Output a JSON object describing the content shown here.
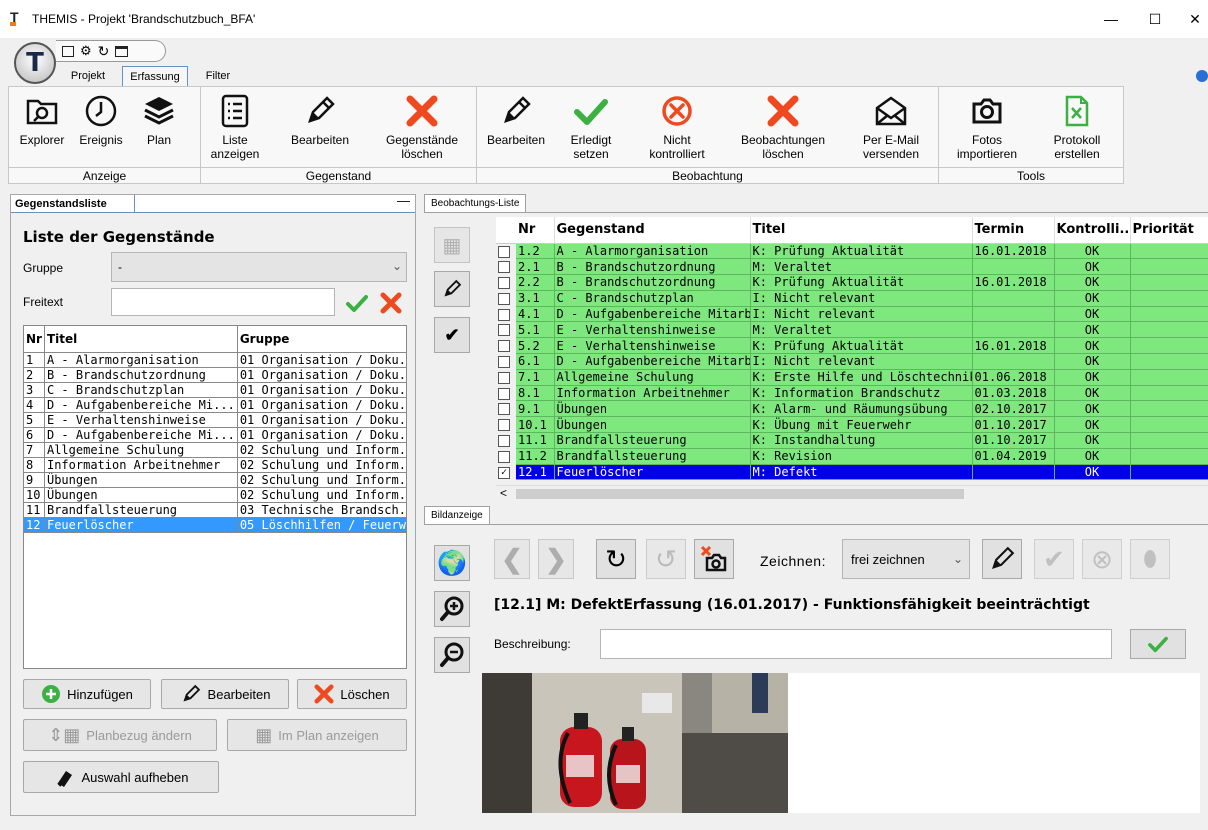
{
  "window": {
    "title": "THEMIS - Projekt 'Brandschutzbuch_BFA'",
    "logo": "T",
    "minimize": "—",
    "maximize": "☐",
    "close": "✕"
  },
  "ribbon_tabs": [
    {
      "label": "Projekt"
    },
    {
      "label": "Erfassung"
    },
    {
      "label": "Filter"
    }
  ],
  "groups": {
    "anzeige": {
      "label": "Anzeige",
      "explorer": "Explorer",
      "ereignis": "Ereignis",
      "plan": "Plan"
    },
    "gegenstand": {
      "label": "Gegenstand",
      "liste_1": "Liste",
      "liste_2": "anzeigen",
      "bearbeiten": "Bearbeiten",
      "loeschen_1": "Gegenstände",
      "loeschen_2": "löschen"
    },
    "beobachtung": {
      "label": "Beobachtung",
      "bearbeiten": "Bearbeiten",
      "erledigt_1": "Erledigt",
      "erledigt_2": "setzen",
      "nicht_1": "Nicht",
      "nicht_2": "kontrolliert",
      "loeschen_1": "Beobachtungen",
      "loeschen_2": "löschen",
      "email_1": "Per E-Mail",
      "email_2": "versenden"
    },
    "tools": {
      "label": "Tools",
      "fotos_1": "Fotos",
      "fotos_2": "importieren",
      "protokoll_1": "Protokoll",
      "protokoll_2": "erstellen"
    }
  },
  "left_panel": {
    "tab": "Gegenstandsliste",
    "collapse": "—",
    "heading": "Liste der Gegenstände",
    "gruppe_label": "Gruppe",
    "gruppe_value": "-",
    "freitext_label": "Freitext",
    "freitext_value": "",
    "columns": [
      "Nr",
      "Titel",
      "Gruppe"
    ],
    "rows": [
      [
        "1",
        "A - Alarmorganisation",
        "01 Organisation / Doku..."
      ],
      [
        "2",
        "B - Brandschutzordnung",
        "01 Organisation / Doku..."
      ],
      [
        "3",
        "C - Brandschutzplan",
        "01 Organisation / Doku..."
      ],
      [
        "4",
        "D - Aufgabenbereiche Mi...",
        "01 Organisation / Doku..."
      ],
      [
        "5",
        "E - Verhaltenshinweise",
        "01 Organisation / Doku..."
      ],
      [
        "6",
        "D - Aufgabenbereiche Mi...",
        "01 Organisation / Doku..."
      ],
      [
        "7",
        "Allgemeine Schulung",
        "02 Schulung und Inform..."
      ],
      [
        "8",
        "Information Arbeitnehmer",
        "02 Schulung und Inform..."
      ],
      [
        "9",
        "Übungen",
        "02 Schulung und Inform..."
      ],
      [
        "10",
        "Übungen",
        "02 Schulung und Inform..."
      ],
      [
        "11",
        "Brandfallsteuerung",
        "03 Technische Brandsch..."
      ],
      [
        "12",
        "Feuerlöscher",
        "05 Löschhilfen / Feuerw..."
      ]
    ],
    "selected_row": 12,
    "btn_add": "Hinzufügen",
    "btn_edit": "Bearbeiten",
    "btn_delete": "Löschen",
    "btn_planbezug": "Planbezug ändern",
    "btn_implan": "Im Plan anzeigen",
    "btn_auswahl": "Auswahl aufheben"
  },
  "obs_panel": {
    "tab": "Beobachtungs-Liste",
    "columns": [
      "Nr",
      "Gegenstand",
      "Titel",
      "Termin",
      "Kontrolli...",
      "Priorität"
    ],
    "rows": [
      [
        "1.2",
        "A - Alarmorganisation",
        "K: Prüfung Aktualität",
        "16.01.2018",
        "OK",
        ""
      ],
      [
        "2.1",
        "B - Brandschutzordnung",
        "M: Veraltet",
        "",
        "OK",
        ""
      ],
      [
        "2.2",
        "B - Brandschutzordnung",
        "K: Prüfung Aktualität",
        "16.01.2018",
        "OK",
        ""
      ],
      [
        "3.1",
        "C - Brandschutzplan",
        "I: Nicht relevant",
        "",
        "OK",
        ""
      ],
      [
        "4.1",
        "D - Aufgabenbereiche Mitarb...",
        "I: Nicht relevant",
        "",
        "OK",
        ""
      ],
      [
        "5.1",
        "E - Verhaltenshinweise",
        "M: Veraltet",
        "",
        "OK",
        ""
      ],
      [
        "5.2",
        "E - Verhaltenshinweise",
        "K: Prüfung Aktualität",
        "16.01.2018",
        "OK",
        ""
      ],
      [
        "6.1",
        "D - Aufgabenbereiche Mitarb...",
        "I: Nicht relevant",
        "",
        "OK",
        ""
      ],
      [
        "7.1",
        "Allgemeine Schulung",
        "K: Erste Hilfe und Löschtechnik",
        "01.06.2018",
        "OK",
        ""
      ],
      [
        "8.1",
        "Information Arbeitnehmer",
        "K: Information Brandschutz",
        "01.03.2018",
        "OK",
        ""
      ],
      [
        "9.1",
        "Übungen",
        "K: Alarm- und Räumungsübung",
        "02.10.2017",
        "OK",
        ""
      ],
      [
        "10.1",
        "Übungen",
        "K: Übung mit Feuerwehr",
        "01.10.2017",
        "OK",
        ""
      ],
      [
        "11.1",
        "Brandfallsteuerung",
        "K: Instandhaltung",
        "01.10.2017",
        "OK",
        ""
      ],
      [
        "11.2",
        "Brandfallsteuerung",
        "K: Revision",
        "01.04.2019",
        "OK",
        ""
      ],
      [
        "12.1",
        "Feuerlöscher",
        "M: Defekt",
        "",
        "OK",
        ""
      ]
    ],
    "checked_row": "12.1",
    "scroll_left": "<"
  },
  "image_panel": {
    "tab": "Bildanzeige",
    "zeichnen_label": "Zeichnen:",
    "zeichnen_value": "frei zeichnen",
    "caption": "[12.1] M: DefektErfassung (16.01.2017) - Funktionsfähigkeit beeinträchtigt",
    "beschreibung_label": "Beschreibung:",
    "beschreibung_value": ""
  },
  "colors": {
    "ok_green": "#7ee87e",
    "selected_blue": "#0000e6",
    "list_select": "#3399ff",
    "accent_green": "#3cb043",
    "delete_red": "#ef4a1f"
  }
}
